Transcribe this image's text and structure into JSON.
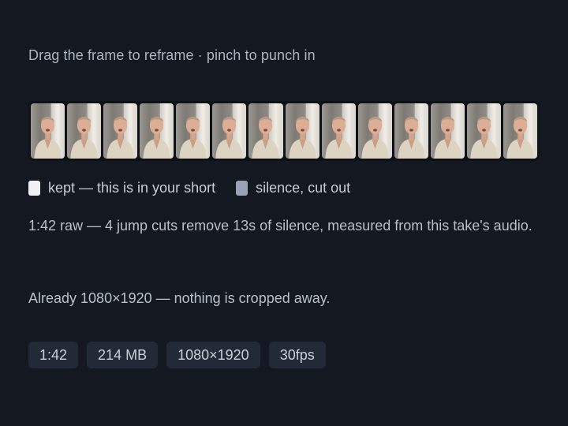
{
  "hint": "Drag the frame to reframe · pinch to punch in",
  "filmstrip": {
    "frame_count": 14
  },
  "legend": {
    "kept": "kept — this is in your short",
    "silence": "silence, cut out"
  },
  "summary": "1:42 raw — 4 jump cuts remove 13s of silence, measured from this take's audio.",
  "crop_note": "Already 1080×1920 — nothing is cropped away.",
  "chips": [
    "1:42",
    "214 MB",
    "1080×1920",
    "30fps"
  ],
  "colors": {
    "background": "#131821",
    "kept": "#eef0f3",
    "silence": "#9aa3b6",
    "chip": "#222a37"
  }
}
